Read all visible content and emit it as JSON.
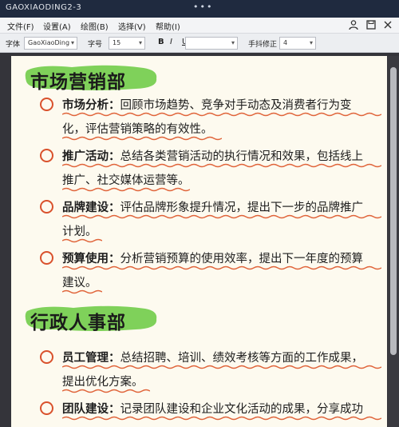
{
  "window": {
    "title": "GAOXIAODING2-3",
    "dots": "•••"
  },
  "menu": {
    "items": [
      "文件(F)",
      "设置(A)",
      "绘图(B)",
      "选择(V)",
      "帮助(I)"
    ]
  },
  "toolbar": {
    "font_label": "字体",
    "font_value": "GaoXiaoDing",
    "size_label": "字号",
    "size_value": "15",
    "bold": "B",
    "italic": "I",
    "underline": "U",
    "color_value": "",
    "jitter_label": "手抖修正",
    "jitter_value": "4"
  },
  "colors": {
    "accent": "#d9512c",
    "highlight": "#7fd15a",
    "paper": "#fdfaef"
  },
  "sections": [
    {
      "title": "市场营销部",
      "items": [
        {
          "label": "市场分析：",
          "line1": "回顾市场趋势、竞争对手动态及消费者行为变",
          "line2": "化，评估营销策略的有效性。"
        },
        {
          "label": "推广活动：",
          "line1": "总结各类营销活动的执行情况和效果，包括线上",
          "line2": "推广、社交媒体运营等。"
        },
        {
          "label": "品牌建设：",
          "line1": "评估品牌形象提升情况，提出下一步的品牌推广",
          "line2": "计划。"
        },
        {
          "label": "预算使用：",
          "line1": "分析营销预算的使用效率，提出下一年度的预算",
          "line2": "建议。"
        }
      ]
    },
    {
      "title": "行政人事部",
      "items": [
        {
          "label": "员工管理：",
          "line1": "总结招聘、培训、绩效考核等方面的工作成果，",
          "line2": "提出优化方案。"
        },
        {
          "label": "团队建设：",
          "line1": "记录团队建设和企业文化活动的成果，分享成功",
          "line2": ""
        }
      ]
    }
  ]
}
